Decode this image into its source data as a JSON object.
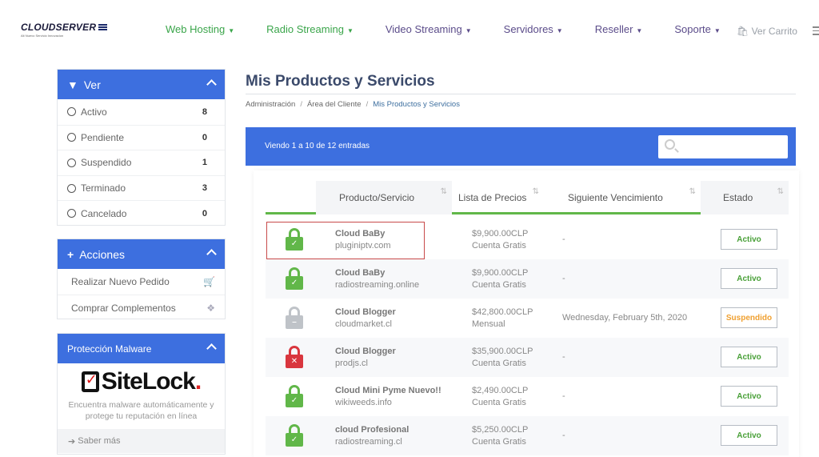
{
  "brand": {
    "name": "CLOUDSERVER",
    "tagline": "Alt Nuevo Servicio Innovacion"
  },
  "nav": {
    "items": [
      {
        "label": "Web Hosting",
        "color": "#3aa54a"
      },
      {
        "label": "Radio Streaming",
        "color": "#3aa54a"
      },
      {
        "label": "Video Streaming",
        "color": "#5b4c8a"
      },
      {
        "label": "Servidores",
        "color": "#5b4c8a"
      },
      {
        "label": "Reseller",
        "color": "#5b4c8a"
      },
      {
        "label": "Soporte",
        "color": "#5b4c8a"
      }
    ],
    "cart": "Ver Carrito"
  },
  "sidebar": {
    "filter": {
      "title": "Ver",
      "items": [
        {
          "label": "Activo",
          "count": "8"
        },
        {
          "label": "Pendiente",
          "count": "0"
        },
        {
          "label": "Suspendido",
          "count": "1"
        },
        {
          "label": "Terminado",
          "count": "3"
        },
        {
          "label": "Cancelado",
          "count": "0"
        }
      ]
    },
    "actions": {
      "title": "Acciones",
      "items": [
        {
          "label": "Realizar Nuevo Pedido",
          "icon": "cart-icon"
        },
        {
          "label": "Comprar Complementos",
          "icon": "cubes-icon"
        }
      ]
    },
    "malware": {
      "title": "Protección Malware",
      "logo_text": "SiteLock",
      "desc": "Encuentra malware automáticamente y protege tu reputación en línea",
      "link": "Saber más"
    }
  },
  "main": {
    "title": "Mis Productos y Servicios",
    "breadcrumb": [
      "Administración",
      "Área del Cliente",
      "Mis Productos y Servicios"
    ],
    "table_info": "Viendo 1 a 10 de 12 entradas",
    "search_placeholder": "",
    "columns": [
      "Producto/Servicio",
      "Lista de Precios",
      "Siguiente Vencimiento",
      "Estado"
    ],
    "rows": [
      {
        "lock": "green",
        "name": "Cloud BaBy",
        "domain": "pluginiptv.com",
        "price": "$9,900.00CLP",
        "cycle": "Cuenta Gratis",
        "due": "-",
        "status": "Activo"
      },
      {
        "lock": "green",
        "name": "Cloud BaBy",
        "domain": "radiostreaming.online",
        "price": "$9,900.00CLP",
        "cycle": "Cuenta Gratis",
        "due": "-",
        "status": "Activo"
      },
      {
        "lock": "grey",
        "name": "Cloud Blogger",
        "domain": "cloudmarket.cl",
        "price": "$42,800.00CLP",
        "cycle": "Mensual",
        "due": "Wednesday, February 5th, 2020",
        "status": "Suspendido"
      },
      {
        "lock": "red",
        "name": "Cloud Blogger",
        "domain": "prodjs.cl",
        "price": "$35,900.00CLP",
        "cycle": "Cuenta Gratis",
        "due": "-",
        "status": "Activo"
      },
      {
        "lock": "green",
        "name": "Cloud Mini Pyme Nuevo!!",
        "domain": "wikiweeds.info",
        "price": "$2,490.00CLP",
        "cycle": "Cuenta Gratis",
        "due": "-",
        "status": "Activo"
      },
      {
        "lock": "green",
        "name": "cloud Profesional",
        "domain": "radiostreaming.cl",
        "price": "$5,250.00CLP",
        "cycle": "Cuenta Gratis",
        "due": "-",
        "status": "Activo"
      }
    ]
  },
  "colors": {
    "accent": "#3d6fdf",
    "green": "#61b749",
    "red": "#d9363e",
    "grey": "#bfc3c8",
    "orange": "#f0a030"
  }
}
